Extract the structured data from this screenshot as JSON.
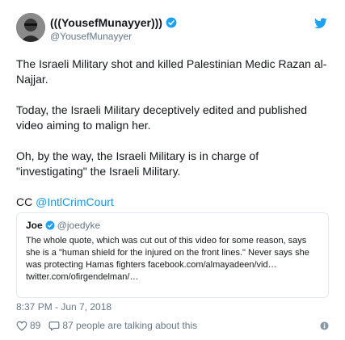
{
  "author": {
    "display_name": "(((YousefMunayyer)))",
    "handle": "@YousefMunayyer"
  },
  "tweet": {
    "paragraphs": [
      "The Israeli Military shot and killed Palestinian Medic Razan al-Najjar.",
      "Today, the Israeli Military deceptively edited and published video aiming to malign her.",
      "Oh, by the way, the Israeli Military is in charge of \"investigating\" the Israeli Military."
    ],
    "cc_prefix": "CC ",
    "cc_mention": "@IntlCrimCourt"
  },
  "quoted": {
    "name": "Joe",
    "handle": "@joedyke",
    "text": "The whole quote, which was cut out of this video for some reason, says she is a \"human shield for the injured on the front lines.\" Never says she was protecting Hamas fighters facebook.com/almayadeen/vid… twitter.com/ofirgendelman/…"
  },
  "timestamp": "8:37 PM - Jun 7, 2018",
  "likes": "89",
  "talking": "87 people are talking about this",
  "colors": {
    "accent": "#1da1f2",
    "link": "#1b95e0",
    "muted": "#657786",
    "like": "#e0245e"
  },
  "icons": [
    "twitter-bird-icon",
    "verified-badge-icon",
    "heart-icon",
    "comment-icon",
    "info-icon"
  ]
}
